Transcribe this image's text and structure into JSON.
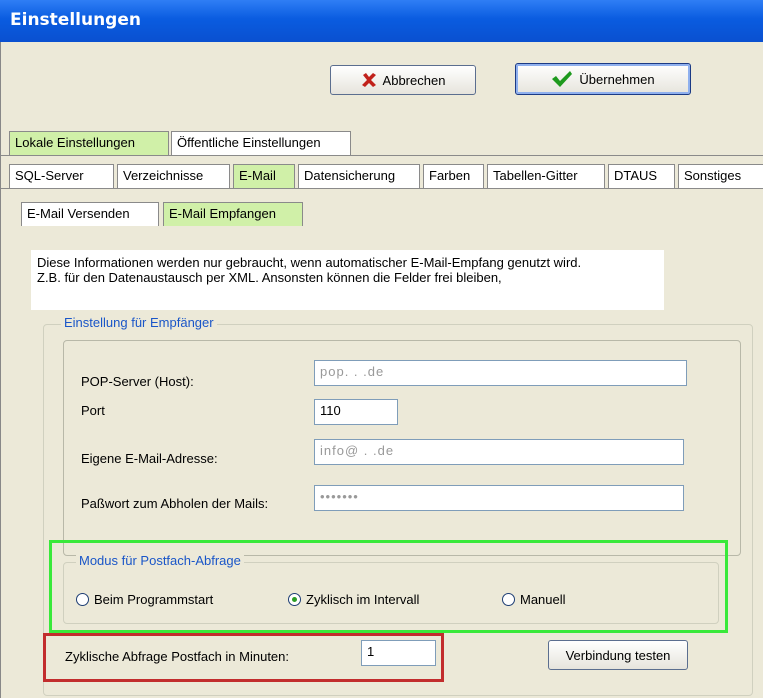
{
  "window": {
    "title": "Einstellungen"
  },
  "toolbar": {
    "cancel_label": "Abbrechen",
    "apply_label": "Übernehmen"
  },
  "tabs_main": [
    "Lokale Einstellungen",
    "Öffentliche Einstellungen"
  ],
  "tabs_sub": [
    "SQL-Server",
    "Verzeichnisse",
    "E-Mail",
    "Datensicherung",
    "Farben",
    "Tabellen-Gitter",
    "DTAUS",
    "Sonstiges"
  ],
  "tabs_email": [
    "E-Mail Versenden",
    "E-Mail Empfangen"
  ],
  "info": {
    "line1": "Diese Informationen werden nur gebraucht, wenn automatischer E-Mail-Empfang genutzt wird.",
    "line2": "Z.B. für den Datenaustausch per XML. Ansonsten können die Felder frei bleiben,"
  },
  "receiver_group": {
    "title": "Einstellung für Empfänger",
    "pop_label": "POP-Server (Host):",
    "pop_value": "pop.  .  .de",
    "port_label": "Port",
    "port_value": "110",
    "email_label": "Eigene E-Mail-Adresse:",
    "email_value": "info@  .  .de",
    "password_label": "Paßwort zum Abholen der Mails:",
    "password_value": "•••••••"
  },
  "mode_group": {
    "title": "Modus für Postfach-Abfrage",
    "options": [
      "Beim Programmstart",
      "Zyklisch im Intervall",
      "Manuell"
    ],
    "selected": "Zyklisch im Intervall"
  },
  "interval": {
    "label": "Zyklische Abfrage Postfach in Minuten:",
    "value": "1"
  },
  "test_button": {
    "label": "Verbindung testen"
  },
  "colors": {
    "tab_selected": "#d0f0a8",
    "highlight_green": "#39e93a",
    "highlight_red": "#c22d2d",
    "group_title": "#1a56c8"
  }
}
